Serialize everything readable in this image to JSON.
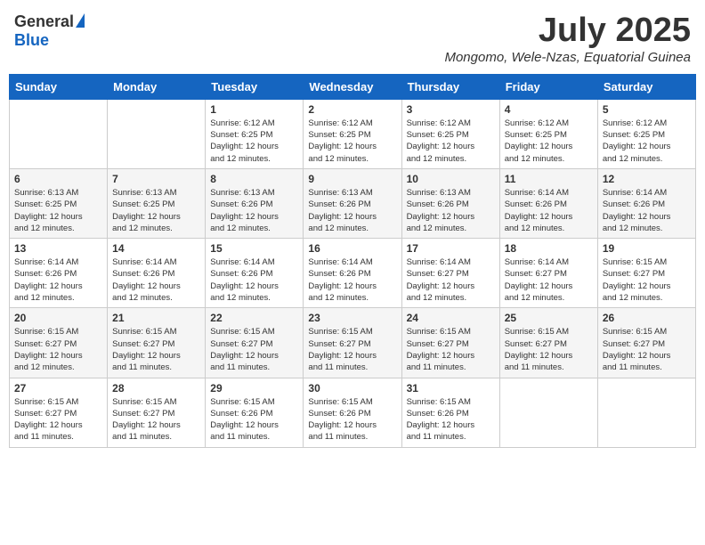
{
  "logo": {
    "general": "General",
    "blue": "Blue"
  },
  "title": {
    "month_year": "July 2025",
    "location": "Mongomo, Wele-Nzas, Equatorial Guinea"
  },
  "weekdays": [
    "Sunday",
    "Monday",
    "Tuesday",
    "Wednesday",
    "Thursday",
    "Friday",
    "Saturday"
  ],
  "weeks": [
    [
      {
        "day": "",
        "info": ""
      },
      {
        "day": "",
        "info": ""
      },
      {
        "day": "1",
        "info": "Sunrise: 6:12 AM\nSunset: 6:25 PM\nDaylight: 12 hours\nand 12 minutes."
      },
      {
        "day": "2",
        "info": "Sunrise: 6:12 AM\nSunset: 6:25 PM\nDaylight: 12 hours\nand 12 minutes."
      },
      {
        "day": "3",
        "info": "Sunrise: 6:12 AM\nSunset: 6:25 PM\nDaylight: 12 hours\nand 12 minutes."
      },
      {
        "day": "4",
        "info": "Sunrise: 6:12 AM\nSunset: 6:25 PM\nDaylight: 12 hours\nand 12 minutes."
      },
      {
        "day": "5",
        "info": "Sunrise: 6:12 AM\nSunset: 6:25 PM\nDaylight: 12 hours\nand 12 minutes."
      }
    ],
    [
      {
        "day": "6",
        "info": "Sunrise: 6:13 AM\nSunset: 6:25 PM\nDaylight: 12 hours\nand 12 minutes."
      },
      {
        "day": "7",
        "info": "Sunrise: 6:13 AM\nSunset: 6:25 PM\nDaylight: 12 hours\nand 12 minutes."
      },
      {
        "day": "8",
        "info": "Sunrise: 6:13 AM\nSunset: 6:26 PM\nDaylight: 12 hours\nand 12 minutes."
      },
      {
        "day": "9",
        "info": "Sunrise: 6:13 AM\nSunset: 6:26 PM\nDaylight: 12 hours\nand 12 minutes."
      },
      {
        "day": "10",
        "info": "Sunrise: 6:13 AM\nSunset: 6:26 PM\nDaylight: 12 hours\nand 12 minutes."
      },
      {
        "day": "11",
        "info": "Sunrise: 6:14 AM\nSunset: 6:26 PM\nDaylight: 12 hours\nand 12 minutes."
      },
      {
        "day": "12",
        "info": "Sunrise: 6:14 AM\nSunset: 6:26 PM\nDaylight: 12 hours\nand 12 minutes."
      }
    ],
    [
      {
        "day": "13",
        "info": "Sunrise: 6:14 AM\nSunset: 6:26 PM\nDaylight: 12 hours\nand 12 minutes."
      },
      {
        "day": "14",
        "info": "Sunrise: 6:14 AM\nSunset: 6:26 PM\nDaylight: 12 hours\nand 12 minutes."
      },
      {
        "day": "15",
        "info": "Sunrise: 6:14 AM\nSunset: 6:26 PM\nDaylight: 12 hours\nand 12 minutes."
      },
      {
        "day": "16",
        "info": "Sunrise: 6:14 AM\nSunset: 6:26 PM\nDaylight: 12 hours\nand 12 minutes."
      },
      {
        "day": "17",
        "info": "Sunrise: 6:14 AM\nSunset: 6:27 PM\nDaylight: 12 hours\nand 12 minutes."
      },
      {
        "day": "18",
        "info": "Sunrise: 6:14 AM\nSunset: 6:27 PM\nDaylight: 12 hours\nand 12 minutes."
      },
      {
        "day": "19",
        "info": "Sunrise: 6:15 AM\nSunset: 6:27 PM\nDaylight: 12 hours\nand 12 minutes."
      }
    ],
    [
      {
        "day": "20",
        "info": "Sunrise: 6:15 AM\nSunset: 6:27 PM\nDaylight: 12 hours\nand 12 minutes."
      },
      {
        "day": "21",
        "info": "Sunrise: 6:15 AM\nSunset: 6:27 PM\nDaylight: 12 hours\nand 11 minutes."
      },
      {
        "day": "22",
        "info": "Sunrise: 6:15 AM\nSunset: 6:27 PM\nDaylight: 12 hours\nand 11 minutes."
      },
      {
        "day": "23",
        "info": "Sunrise: 6:15 AM\nSunset: 6:27 PM\nDaylight: 12 hours\nand 11 minutes."
      },
      {
        "day": "24",
        "info": "Sunrise: 6:15 AM\nSunset: 6:27 PM\nDaylight: 12 hours\nand 11 minutes."
      },
      {
        "day": "25",
        "info": "Sunrise: 6:15 AM\nSunset: 6:27 PM\nDaylight: 12 hours\nand 11 minutes."
      },
      {
        "day": "26",
        "info": "Sunrise: 6:15 AM\nSunset: 6:27 PM\nDaylight: 12 hours\nand 11 minutes."
      }
    ],
    [
      {
        "day": "27",
        "info": "Sunrise: 6:15 AM\nSunset: 6:27 PM\nDaylight: 12 hours\nand 11 minutes."
      },
      {
        "day": "28",
        "info": "Sunrise: 6:15 AM\nSunset: 6:27 PM\nDaylight: 12 hours\nand 11 minutes."
      },
      {
        "day": "29",
        "info": "Sunrise: 6:15 AM\nSunset: 6:26 PM\nDaylight: 12 hours\nand 11 minutes."
      },
      {
        "day": "30",
        "info": "Sunrise: 6:15 AM\nSunset: 6:26 PM\nDaylight: 12 hours\nand 11 minutes."
      },
      {
        "day": "31",
        "info": "Sunrise: 6:15 AM\nSunset: 6:26 PM\nDaylight: 12 hours\nand 11 minutes."
      },
      {
        "day": "",
        "info": ""
      },
      {
        "day": "",
        "info": ""
      }
    ]
  ]
}
